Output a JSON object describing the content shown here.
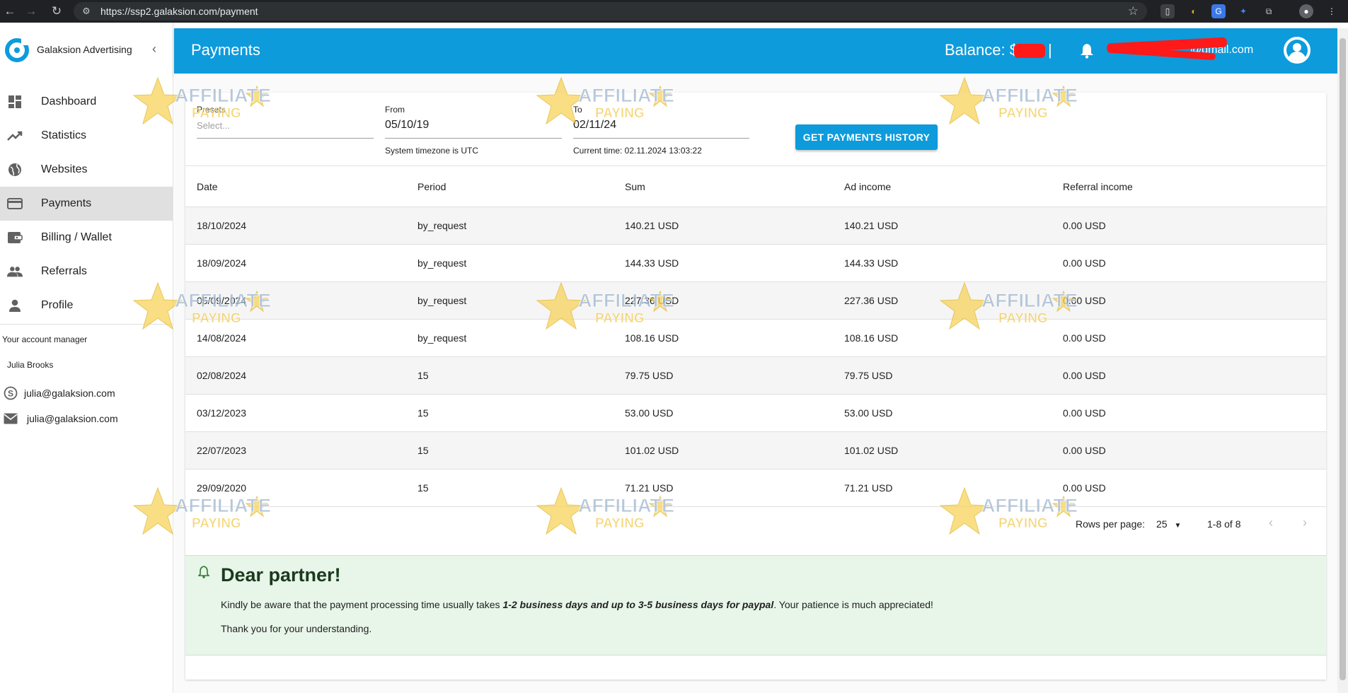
{
  "browser": {
    "url": "https://ssp2.galaksion.com/payment"
  },
  "sidebar": {
    "brand": "Galaksion Advertising",
    "items": [
      {
        "label": "Dashboard",
        "icon": "dashboard-icon"
      },
      {
        "label": "Statistics",
        "icon": "trending-up-icon"
      },
      {
        "label": "Websites",
        "icon": "globe-icon"
      },
      {
        "label": "Payments",
        "icon": "credit-card-icon",
        "active": true
      },
      {
        "label": "Billing / Wallet",
        "icon": "wallet-icon"
      },
      {
        "label": "Referrals",
        "icon": "people-icon"
      },
      {
        "label": "Profile",
        "icon": "person-icon"
      }
    ],
    "manager": {
      "title": "Your account manager",
      "name": "Julia Brooks",
      "skype": "julia@galaksion.com",
      "email": "julia@galaksion.com"
    }
  },
  "header": {
    "title": "Payments",
    "balance_label": "Balance: $",
    "email_visible": "@gmail.com"
  },
  "filters": {
    "presets": {
      "label": "Presets",
      "placeholder": "Select..."
    },
    "from": {
      "label": "From",
      "value": "05/10/19",
      "hint": "System timezone is UTC"
    },
    "to": {
      "label": "To",
      "value": "02/11/24",
      "hint": "Current time: 02.11.2024 13:03:22"
    },
    "submit_label": "GET PAYMENTS HISTORY"
  },
  "table": {
    "headers": [
      "Date",
      "Period",
      "Sum",
      "Ad income",
      "Referral income"
    ],
    "rows": [
      [
        "18/10/2024",
        "by_request",
        "140.21 USD",
        "140.21 USD",
        "0.00 USD"
      ],
      [
        "18/09/2024",
        "by_request",
        "144.33 USD",
        "144.33 USD",
        "0.00 USD"
      ],
      [
        "05/09/2024",
        "by_request",
        "227.36 USD",
        "227.36 USD",
        "0.00 USD"
      ],
      [
        "14/08/2024",
        "by_request",
        "108.16 USD",
        "108.16 USD",
        "0.00 USD"
      ],
      [
        "02/08/2024",
        "15",
        "79.75 USD",
        "79.75 USD",
        "0.00 USD"
      ],
      [
        "03/12/2023",
        "15",
        "53.00 USD",
        "53.00 USD",
        "0.00 USD"
      ],
      [
        "22/07/2023",
        "15",
        "101.02 USD",
        "101.02 USD",
        "0.00 USD"
      ],
      [
        "29/09/2020",
        "15",
        "71.21 USD",
        "71.21 USD",
        "0.00 USD"
      ]
    ]
  },
  "pagination": {
    "rows_label": "Rows per page:",
    "rows_value": "25",
    "range": "1-8 of 8"
  },
  "notice": {
    "title": "Dear partner!",
    "body_before": "Kindly be aware that the payment processing time usually takes ",
    "body_bold": "1-2 business days and up to 3-5 business days for paypal",
    "body_after": ". Your patience is much appreciated!",
    "thanks": "Thank you for your understanding."
  },
  "watermark": {
    "line1": "AFFILIATE",
    "line2": "PAYING"
  },
  "colors": {
    "primary": "#0d9bdc",
    "notice_bg": "#e8f5e9",
    "active_nav": "#e0e0e0",
    "redaction": "#ff1a1a"
  }
}
